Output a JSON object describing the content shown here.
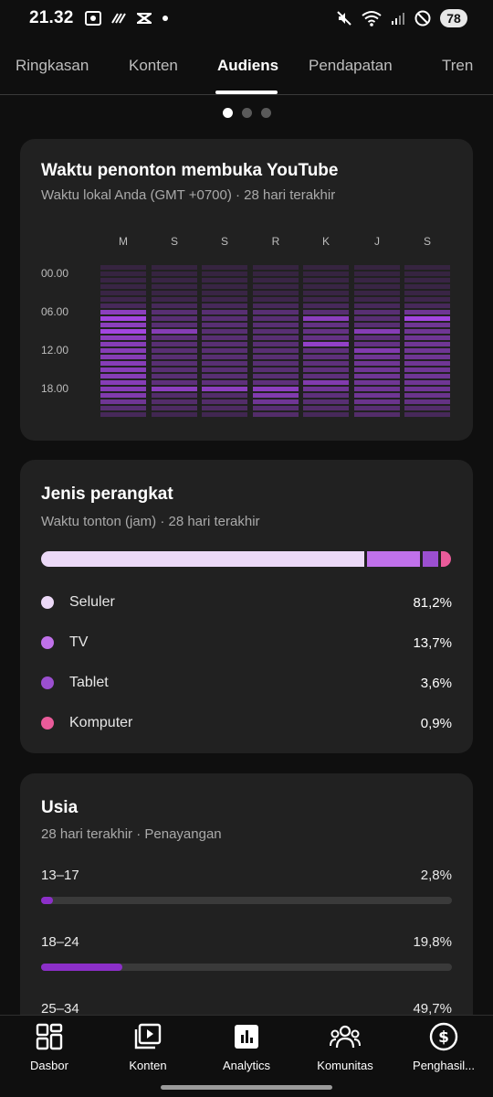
{
  "status_bar": {
    "time": "21.32",
    "battery": "78",
    "left_icons": [
      "screenshot-icon",
      "media-icon",
      "capcut-icon",
      "dot-icon"
    ],
    "right_icons": [
      "mute-icon",
      "wifi-icon",
      "signal-icon",
      "dnd-icon"
    ]
  },
  "tabs": [
    {
      "label": "Ringkasan",
      "active": false
    },
    {
      "label": "Konten",
      "active": false
    },
    {
      "label": "Audiens",
      "active": true
    },
    {
      "label": "Pendapatan",
      "active": false
    },
    {
      "label": "Tren",
      "active": false
    }
  ],
  "pager": {
    "count": 3,
    "active": 0
  },
  "watch_time_card": {
    "title": "Waktu penonton membuka YouTube",
    "subtitle": "Waktu lokal Anda (GMT +0700) · 28 hari terakhir",
    "days": [
      "M",
      "S",
      "S",
      "R",
      "K",
      "J",
      "S"
    ],
    "hours": [
      "00.00",
      "06.00",
      "12.00",
      "18.00"
    ]
  },
  "chart_data": {
    "type": "heatmap",
    "title": "Waktu penonton membuka YouTube",
    "x": [
      "M",
      "S",
      "S",
      "R",
      "K",
      "J",
      "S"
    ],
    "y_ticks": [
      "00.00",
      "06.00",
      "12.00",
      "18.00"
    ],
    "rows": 24,
    "intensity": [
      [
        0.05,
        0.05,
        0.05,
        0.05,
        0.05,
        0.05,
        0.05
      ],
      [
        0.05,
        0.05,
        0.05,
        0.05,
        0.05,
        0.05,
        0.05
      ],
      [
        0.08,
        0.08,
        0.08,
        0.08,
        0.08,
        0.08,
        0.08
      ],
      [
        0.08,
        0.08,
        0.08,
        0.08,
        0.08,
        0.08,
        0.08
      ],
      [
        0.08,
        0.08,
        0.08,
        0.08,
        0.08,
        0.08,
        0.08
      ],
      [
        0.12,
        0.12,
        0.12,
        0.12,
        0.12,
        0.12,
        0.12
      ],
      [
        0.2,
        0.2,
        0.2,
        0.2,
        0.2,
        0.2,
        0.2
      ],
      [
        0.8,
        0.35,
        0.35,
        0.35,
        0.35,
        0.35,
        0.55
      ],
      [
        1.0,
        0.35,
        0.35,
        0.35,
        0.8,
        0.35,
        1.0
      ],
      [
        0.8,
        0.35,
        0.35,
        0.35,
        0.45,
        0.35,
        0.55
      ],
      [
        1.0,
        0.75,
        0.35,
        0.35,
        0.45,
        0.75,
        0.55
      ],
      [
        0.8,
        0.4,
        0.35,
        0.35,
        0.45,
        0.4,
        0.55
      ],
      [
        0.75,
        0.35,
        0.35,
        0.35,
        0.85,
        0.45,
        0.55
      ],
      [
        0.75,
        0.35,
        0.35,
        0.35,
        0.4,
        0.7,
        0.55
      ],
      [
        0.75,
        0.35,
        0.35,
        0.35,
        0.4,
        0.55,
        0.55
      ],
      [
        0.75,
        0.35,
        0.35,
        0.35,
        0.4,
        0.55,
        0.55
      ],
      [
        0.75,
        0.35,
        0.35,
        0.35,
        0.4,
        0.55,
        0.55
      ],
      [
        0.75,
        0.35,
        0.35,
        0.35,
        0.4,
        0.55,
        0.55
      ],
      [
        0.75,
        0.4,
        0.4,
        0.4,
        0.7,
        0.55,
        0.55
      ],
      [
        0.75,
        0.8,
        0.8,
        0.8,
        0.55,
        0.55,
        0.55
      ],
      [
        0.7,
        0.3,
        0.3,
        0.7,
        0.4,
        0.55,
        0.5
      ],
      [
        0.55,
        0.3,
        0.3,
        0.55,
        0.35,
        0.5,
        0.45
      ],
      [
        0.35,
        0.25,
        0.25,
        0.35,
        0.3,
        0.35,
        0.3
      ],
      [
        0.2,
        0.15,
        0.15,
        0.3,
        0.2,
        0.3,
        0.2
      ]
    ]
  },
  "device_card": {
    "title": "Jenis perangkat",
    "subtitle": "Waktu tonton (jam) · 28 hari terakhir",
    "items": [
      {
        "label": "Seluler",
        "value": "81,2%",
        "share": 81.2,
        "color": "#ecd9f7"
      },
      {
        "label": "TV",
        "value": "13,7%",
        "share": 13.7,
        "color": "#c071ea"
      },
      {
        "label": "Tablet",
        "value": "3,6%",
        "share": 3.6,
        "color": "#9b4fd0"
      },
      {
        "label": "Komputer",
        "value": "0,9%",
        "share": 0.9,
        "color": "#ea5b9a"
      }
    ]
  },
  "age_card": {
    "title": "Usia",
    "subtitle": "28 hari terakhir · Penayangan",
    "items": [
      {
        "label": "13–17",
        "value": "2,8%",
        "share": 2.8
      },
      {
        "label": "18–24",
        "value": "19,8%",
        "share": 19.8
      },
      {
        "label": "25–34",
        "value": "49,7%",
        "share": 49.7
      }
    ]
  },
  "bottom_nav": [
    {
      "label": "Dasbor",
      "icon": "dashboard-icon"
    },
    {
      "label": "Konten",
      "icon": "content-icon"
    },
    {
      "label": "Analytics",
      "icon": "analytics-icon"
    },
    {
      "label": "Komunitas",
      "icon": "community-icon"
    },
    {
      "label": "Penghasil...",
      "icon": "earn-icon"
    }
  ]
}
